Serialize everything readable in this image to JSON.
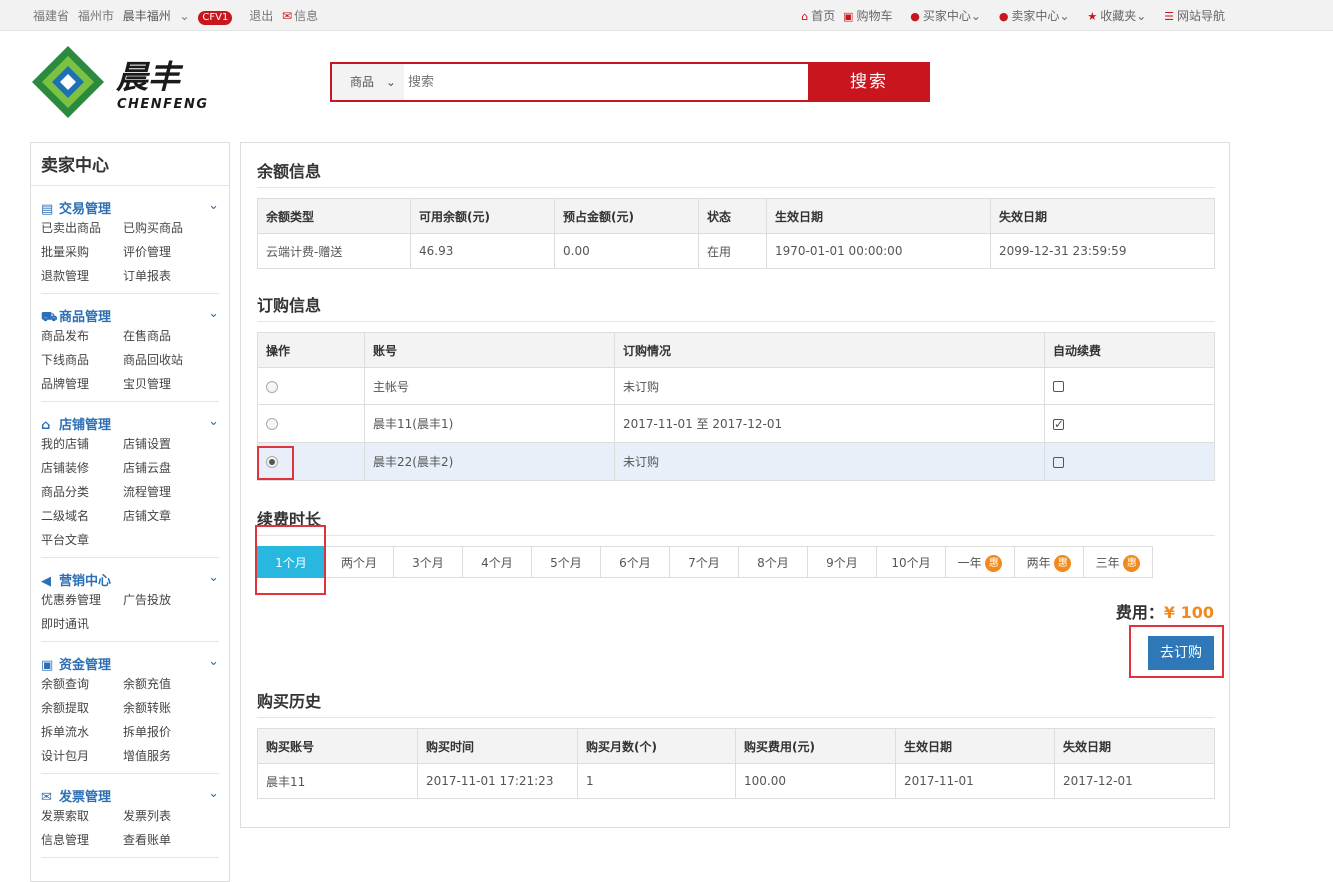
{
  "topbar": {
    "province": "福建省",
    "city": "福州市",
    "user": "晨丰福州",
    "badge": "CFV1",
    "logout": "退出",
    "message": "信息",
    "home": "首页",
    "cart": "购物车",
    "buyer_center": "买家中心",
    "seller_center": "卖家中心",
    "favorites": "收藏夹",
    "site_nav": "网站导航"
  },
  "logo": {
    "cn": "晨丰",
    "en": "CHENFENG"
  },
  "search": {
    "category": "商品",
    "placeholder": "搜索",
    "button": "搜索"
  },
  "sidebar": {
    "title": "卖家中心",
    "sections": [
      {
        "title": "交易管理",
        "icon": "list-icon",
        "items": [
          "已卖出商品",
          "已购买商品",
          "批量采购",
          "评价管理",
          "退款管理",
          "订单报表"
        ]
      },
      {
        "title": "商品管理",
        "icon": "truck-icon",
        "items": [
          "商品发布",
          "在售商品",
          "下线商品",
          "商品回收站",
          "品牌管理",
          "宝贝管理"
        ]
      },
      {
        "title": "店铺管理",
        "icon": "home-icon",
        "items": [
          "我的店铺",
          "店铺设置",
          "店铺装修",
          "店铺云盘",
          "商品分类",
          "流程管理",
          "二级域名",
          "店铺文章",
          "平台文章"
        ]
      },
      {
        "title": "营销中心",
        "icon": "speaker-icon",
        "items": [
          "优惠券管理",
          "广告投放",
          "即时通讯"
        ]
      },
      {
        "title": "资金管理",
        "icon": "money-icon",
        "items": [
          "余额查询",
          "余额充值",
          "余额提取",
          "余额转账",
          "拆单流水",
          "拆单报价",
          "设计包月",
          "增值服务"
        ]
      },
      {
        "title": "发票管理",
        "icon": "envelope-icon",
        "items": [
          "发票索取",
          "发票列表",
          "信息管理",
          "查看账单"
        ]
      }
    ]
  },
  "balance": {
    "title": "余额信息",
    "headers": [
      "余额类型",
      "可用余额(元)",
      "预占金额(元)",
      "状态",
      "生效日期",
      "失效日期"
    ],
    "rows": [
      [
        "云端计费-赠送",
        "46.93",
        "0.00",
        "在用",
        "1970-01-01 00:00:00",
        "2099-12-31 23:59:59"
      ]
    ]
  },
  "subscription": {
    "title": "订购信息",
    "headers": [
      "操作",
      "账号",
      "订购情况",
      "自动续费"
    ],
    "rows": [
      {
        "account": "主帐号",
        "status": "未订购",
        "selected": false,
        "auto": false
      },
      {
        "account": "晨丰11(晨丰1)",
        "status": "2017-11-01 至 2017-12-01",
        "selected": false,
        "auto": true
      },
      {
        "account": "晨丰22(晨丰2)",
        "status": "未订购",
        "selected": true,
        "auto": false
      }
    ]
  },
  "renewal": {
    "title": "续费时长",
    "options": [
      "1个月",
      "两个月",
      "3个月",
      "4个月",
      "5个月",
      "6个月",
      "7个月",
      "8个月",
      "9个月",
      "10个月",
      "一年",
      "两年",
      "三年"
    ],
    "selected": "1个月",
    "promo_badge": "惠"
  },
  "fee": {
    "label": "费用：",
    "currency": "¥",
    "amount": "100"
  },
  "order_button": "去订购",
  "history": {
    "title": "购买历史",
    "headers": [
      "购买账号",
      "购买时间",
      "购买月数(个)",
      "购买费用(元)",
      "生效日期",
      "失效日期"
    ],
    "rows": [
      [
        "晨丰11",
        "2017-11-01 17:21:23",
        "1",
        "100.00",
        "2017-11-01",
        "2017-12-01"
      ]
    ]
  },
  "colors": {
    "brand_red": "#c9151e",
    "link_blue": "#2d6fb5",
    "active_tab": "#27b7df",
    "promo_orange": "#f08a1e",
    "button_blue": "#2e78b8",
    "highlight_box": "#e0333b"
  }
}
